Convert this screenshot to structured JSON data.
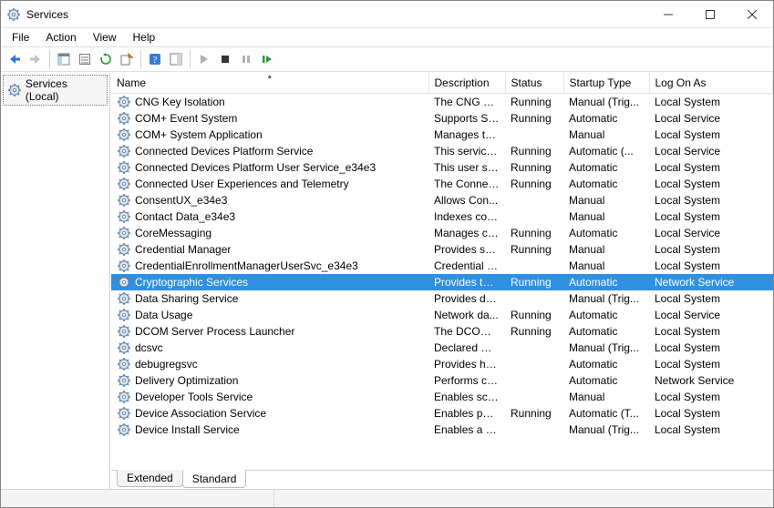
{
  "window": {
    "title": "Services"
  },
  "menu": {
    "file": "File",
    "action": "Action",
    "view": "View",
    "help": "Help"
  },
  "nav": {
    "root": "Services (Local)"
  },
  "columns": {
    "name": "Name",
    "description": "Description",
    "status": "Status",
    "startup": "Startup Type",
    "logon": "Log On As"
  },
  "tabs": {
    "extended": "Extended",
    "standard": "Standard"
  },
  "selected_index": 11,
  "services": [
    {
      "name": "CNG Key Isolation",
      "description": "The CNG ke...",
      "status": "Running",
      "startup": "Manual (Trig...",
      "logon": "Local System"
    },
    {
      "name": "COM+ Event System",
      "description": "Supports Sy...",
      "status": "Running",
      "startup": "Automatic",
      "logon": "Local Service"
    },
    {
      "name": "COM+ System Application",
      "description": "Manages th...",
      "status": "",
      "startup": "Manual",
      "logon": "Local System"
    },
    {
      "name": "Connected Devices Platform Service",
      "description": "This service ...",
      "status": "Running",
      "startup": "Automatic (...",
      "logon": "Local Service"
    },
    {
      "name": "Connected Devices Platform User Service_e34e3",
      "description": "This user ser...",
      "status": "Running",
      "startup": "Automatic",
      "logon": "Local System"
    },
    {
      "name": "Connected User Experiences and Telemetry",
      "description": "The Connec...",
      "status": "Running",
      "startup": "Automatic",
      "logon": "Local System"
    },
    {
      "name": "ConsentUX_e34e3",
      "description": "Allows Con...",
      "status": "",
      "startup": "Manual",
      "logon": "Local System"
    },
    {
      "name": "Contact Data_e34e3",
      "description": "Indexes con...",
      "status": "",
      "startup": "Manual",
      "logon": "Local System"
    },
    {
      "name": "CoreMessaging",
      "description": "Manages co...",
      "status": "Running",
      "startup": "Automatic",
      "logon": "Local Service"
    },
    {
      "name": "Credential Manager",
      "description": "Provides se...",
      "status": "Running",
      "startup": "Manual",
      "logon": "Local System"
    },
    {
      "name": "CredentialEnrollmentManagerUserSvc_e34e3",
      "description": "Credential E...",
      "status": "",
      "startup": "Manual",
      "logon": "Local System"
    },
    {
      "name": "Cryptographic Services",
      "description": "Provides thr...",
      "status": "Running",
      "startup": "Automatic",
      "logon": "Network Service"
    },
    {
      "name": "Data Sharing Service",
      "description": "Provides da...",
      "status": "",
      "startup": "Manual (Trig...",
      "logon": "Local System"
    },
    {
      "name": "Data Usage",
      "description": "Network da...",
      "status": "Running",
      "startup": "Automatic",
      "logon": "Local Service"
    },
    {
      "name": "DCOM Server Process Launcher",
      "description": "The DCOML...",
      "status": "Running",
      "startup": "Automatic",
      "logon": "Local System"
    },
    {
      "name": "dcsvc",
      "description": "Declared Co...",
      "status": "",
      "startup": "Manual (Trig...",
      "logon": "Local System"
    },
    {
      "name": "debugregsvc",
      "description": "Provides hel...",
      "status": "",
      "startup": "Automatic",
      "logon": "Local System"
    },
    {
      "name": "Delivery Optimization",
      "description": "Performs co...",
      "status": "",
      "startup": "Automatic",
      "logon": "Network Service"
    },
    {
      "name": "Developer Tools Service",
      "description": "Enables sce...",
      "status": "",
      "startup": "Manual",
      "logon": "Local System"
    },
    {
      "name": "Device Association Service",
      "description": "Enables pair...",
      "status": "Running",
      "startup": "Automatic (T...",
      "logon": "Local System"
    },
    {
      "name": "Device Install Service",
      "description": "Enables a c...",
      "status": "",
      "startup": "Manual (Trig...",
      "logon": "Local System"
    }
  ]
}
